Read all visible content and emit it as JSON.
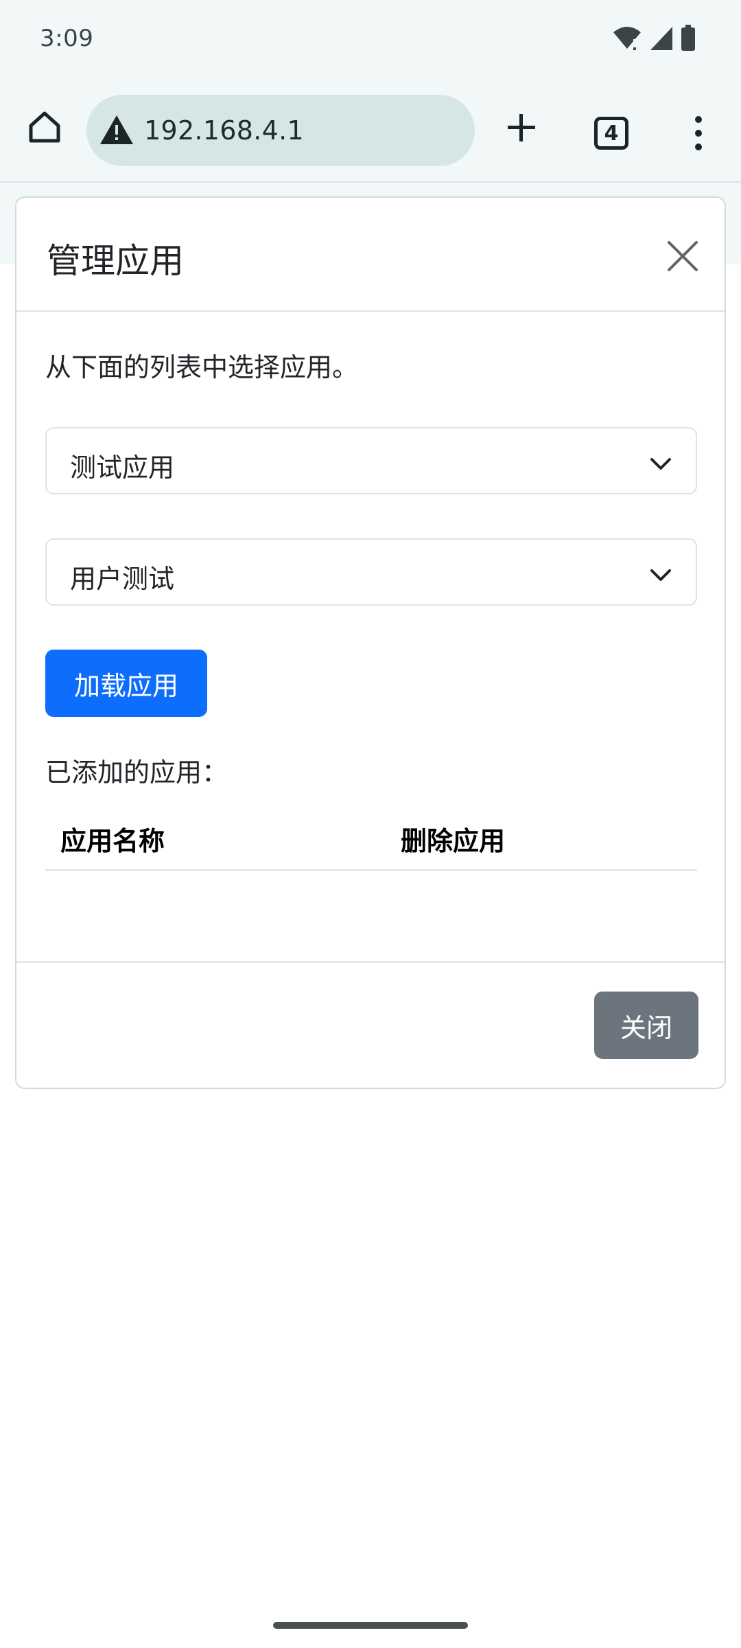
{
  "status_bar": {
    "time": "3:09"
  },
  "browser": {
    "url": "192.168.4.1",
    "tab_count": "4",
    "icons": [
      "home-icon",
      "warning-icon",
      "plus-icon",
      "tabs-icon",
      "more-vert-icon"
    ]
  },
  "modal": {
    "title": "管理应用",
    "instruction": "从下面的列表中选择应用。",
    "select_app": {
      "value": "测试应用"
    },
    "select_user": {
      "value": "用户测试"
    },
    "load_button": "加载应用",
    "added_label": "已添加的应用：",
    "table": {
      "headers": [
        "应用名称",
        "删除应用"
      ],
      "rows": []
    },
    "close_button": "关闭"
  },
  "colors": {
    "primary": "#0d6efd",
    "secondary": "#6c757d",
    "chrome_bg": "#f2f8f8",
    "url_pill": "#d6e6e7"
  }
}
